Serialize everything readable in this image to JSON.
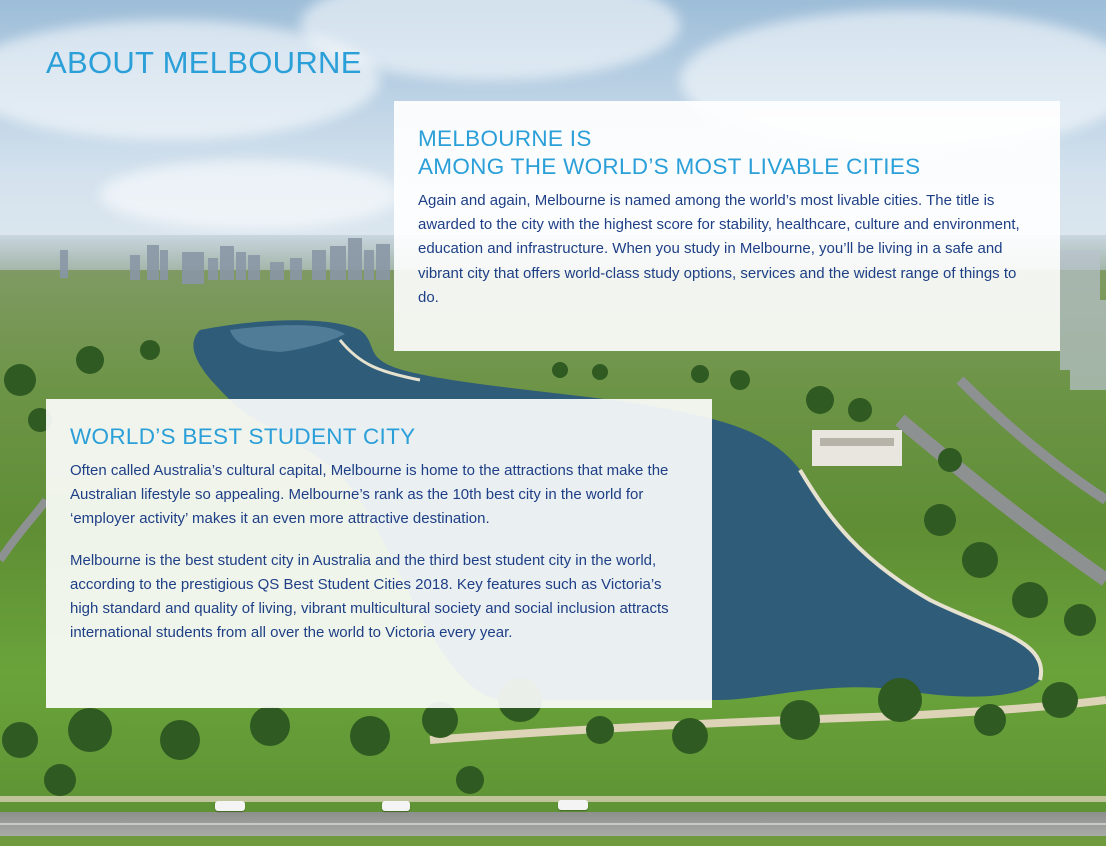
{
  "page": {
    "title": "ABOUT MELBOURNE"
  },
  "livable_panel": {
    "heading_line1": "MELBOURNE IS",
    "heading_line2": "AMONG THE WORLD’S MOST LIVABLE CITIES",
    "body": "Again and again, Melbourne is named among the world’s most livable cities. The title is awarded to the city with the highest score for stability, healthcare, culture and environment, education and infrastructure. When you study in Melbourne, you’ll be living in a safe and vibrant city that offers world-class study options, services and the widest range of things to do."
  },
  "student_panel": {
    "heading": "WORLD’S BEST STUDENT CITY",
    "paragraph1": "Often called Australia’s cultural capital, Melbourne is home to the attractions that make the Australian lifestyle so appealing. Melbourne’s rank as the 10th best city in the world for ‘employer activity’ makes it an even more attractive destination.",
    "paragraph2": "Melbourne is the best student city in Australia and the third best student city in the world, according to the prestigious QS Best Student Cities 2018. Key features such as Victoria’s high standard and quality of living, vibrant multicultural society and social inclusion attracts international students from all over the world to Victoria every year."
  },
  "colors": {
    "accent_blue": "#2a9fd8",
    "body_navy": "#1e3f86",
    "panel_bg": "#ffffff"
  }
}
